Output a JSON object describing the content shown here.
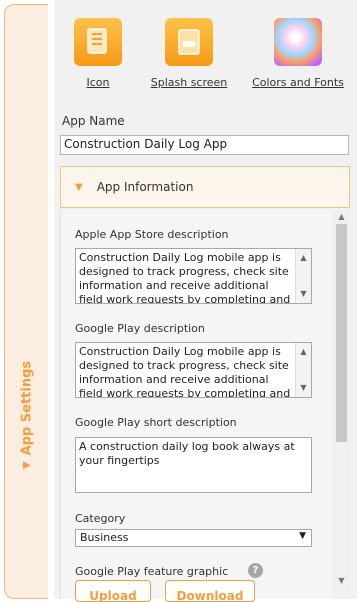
{
  "side_tab": {
    "label": "App Settings"
  },
  "icons": [
    {
      "name": "icon",
      "label": "Icon"
    },
    {
      "name": "splash",
      "label": "Splash screen"
    },
    {
      "name": "colors",
      "label": "Colors and Fonts"
    }
  ],
  "app_name": {
    "label": "App Name",
    "value": "Construction Daily Log App"
  },
  "section": {
    "title": "App Information"
  },
  "fields": {
    "apple_desc": {
      "label": "Apple App Store description",
      "value": "Construction Daily Log mobile app is designed to track progress, check site information and receive additional field work requests by completing and"
    },
    "google_desc": {
      "label": "Google Play description",
      "value": "Construction Daily Log mobile app is designed to track progress, check site information and receive additional field work requests by completing and"
    },
    "google_short": {
      "label": "Google Play short description",
      "value": "A construction daily log book always at your fingertips"
    },
    "category": {
      "label": "Category",
      "value": "Business"
    },
    "feature_graphic": {
      "label": "Google Play feature graphic",
      "help": "?",
      "upload": "Upload",
      "download": "Download"
    }
  },
  "colors": {
    "accent": "#f0a040",
    "tab_background": "#fbeee0"
  }
}
